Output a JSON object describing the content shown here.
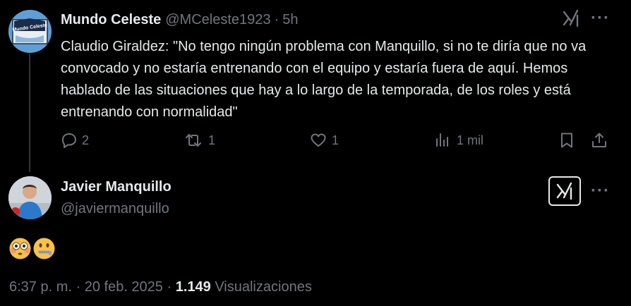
{
  "post1": {
    "author_name": "Mundo Celeste",
    "author_handle": "@MCeleste1923",
    "separator": "·",
    "time": "5h",
    "text": "Claudio Giraldez: \"No tengo ningún problema con Manquillo, si no te diría que no va convocado y no estaría entrenando con el equipo y estaría fuera de aquí. Hemos hablado de las situaciones que hay a lo largo de la temporada, de los roles y está entrenando con normalidad\"",
    "actions": {
      "replies": "2",
      "reposts": "1",
      "likes": "1",
      "views": "1 mil"
    },
    "avatar_text": "Mundo Celeste",
    "more_label": "···"
  },
  "post2": {
    "author_name": "Javier Manquillo",
    "author_handle": "@javiermanquillo",
    "more_label": "···",
    "emojis": [
      "flushed-face",
      "face-with-open-mouth-and-zipper"
    ],
    "date_time": "6:37 p. m. · 20 feb. 2025 · ",
    "views_count": "1.149",
    "views_label": " Visualizaciones"
  },
  "colors": {
    "background": "#000000",
    "text": "#e7e9ea",
    "secondary": "#71767b",
    "avatar_blue": "#5f9fd6",
    "emoji_yellow": "#f6c14d"
  }
}
